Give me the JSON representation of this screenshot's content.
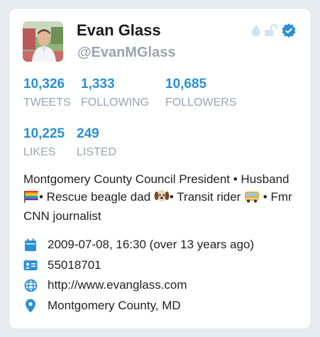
{
  "profile": {
    "name": "Evan Glass",
    "handle": "@EvanMGlass"
  },
  "badges": [
    "drop-icon",
    "unlock-icon",
    "verified-icon"
  ],
  "stats": {
    "tweets": {
      "value": "10,326",
      "label": "TWEETS"
    },
    "following": {
      "value": "1,333",
      "label": "FOLLOWING"
    },
    "followers": {
      "value": "10,685",
      "label": "FOLLOWERS"
    },
    "likes": {
      "value": "10,225",
      "label": "LIKES"
    },
    "listed": {
      "value": "249",
      "label": "LISTED"
    }
  },
  "bio": {
    "part1": "Montgomery County Council President • Husband ",
    "part2": "• Rescue beagle dad ",
    "part3": "• Transit rider ",
    "part4": " • Fmr CNN journalist"
  },
  "meta": {
    "joined": "2009-07-08, 16:30 (over 13 years ago)",
    "user_id": "55018701",
    "website": "http://www.evanglass.com",
    "location": "Montgomery County, MD"
  },
  "colors": {
    "accent": "#2b8fd6",
    "muted": "#9aa4ae",
    "badge_light": "#cfe3f5"
  }
}
